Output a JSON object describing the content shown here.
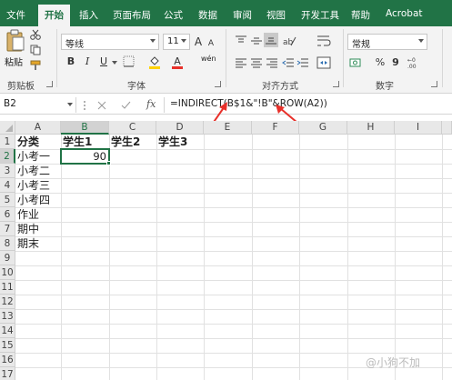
{
  "ribbon_tabs": [
    "文件",
    "开始",
    "插入",
    "页面布局",
    "公式",
    "数据",
    "审阅",
    "视图",
    "开发工具",
    "帮助",
    "Acrobat"
  ],
  "active_tab": "开始",
  "clipboard": {
    "paste_label": "粘贴",
    "group_label": "剪贴板"
  },
  "font": {
    "name": "等线",
    "size": "11",
    "bold": "B",
    "italic": "I",
    "underline": "U",
    "grow": "A",
    "shrink": "A",
    "color_glyph": "A",
    "wen": "wén",
    "group_label": "字体"
  },
  "alignment": {
    "group_label": "对齐方式"
  },
  "number": {
    "format": "常规",
    "percent": "%",
    "comma": "9",
    "group_label": "数字"
  },
  "formula_bar": {
    "name_box": "B2",
    "fx": "fx",
    "formula": "=INDIRECT(B$1&\"!B\"&ROW(A2))"
  },
  "columns": [
    "A",
    "B",
    "C",
    "D",
    "E",
    "F",
    "G",
    "H",
    "I"
  ],
  "selected_column": "B",
  "rows": [
    "1",
    "2",
    "3",
    "4",
    "5",
    "6",
    "7",
    "8",
    "9",
    "10",
    "11",
    "12",
    "13",
    "14",
    "15",
    "16",
    "17"
  ],
  "selected_row": "2",
  "cells": {
    "A1": "分类",
    "B1": "学生1",
    "C1": "学生2",
    "D1": "学生3",
    "A2": "小考一",
    "B2": "90",
    "A3": "小考二",
    "A4": "小考三",
    "A5": "小考四",
    "A6": "作业",
    "A7": "期中",
    "A8": "期末"
  },
  "watermark": "@小狗不加",
  "colors": {
    "accent": "#217346",
    "annotation_arrow": "#e8302a"
  }
}
